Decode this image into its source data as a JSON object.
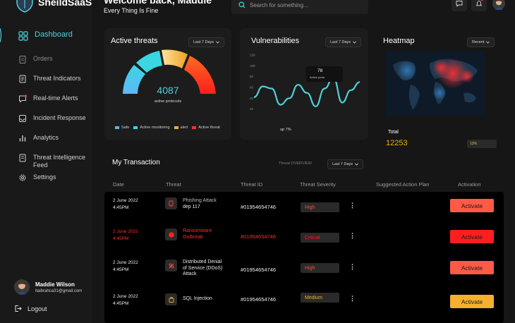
{
  "brand": {
    "name": "SheildSaaS"
  },
  "header": {
    "greeting": "Welcome back, Maddie",
    "tagline": "Every Thing Is Fine",
    "search_placeholder": "Search for something..."
  },
  "sidebar": {
    "items": [
      {
        "label": "Dashboard",
        "icon": "grid-icon",
        "active": true
      },
      {
        "label": "Orders",
        "icon": "clipboard-icon"
      },
      {
        "label": "Threat Indicators",
        "icon": "document-icon"
      },
      {
        "label": "Real-time Alerts",
        "icon": "alert-message-icon"
      },
      {
        "label": "Incident Response",
        "icon": "inbox-icon"
      },
      {
        "label": "Analytics",
        "icon": "bar-chart-icon"
      },
      {
        "label": "Threat Intelligence Feed",
        "icon": "feed-document-icon"
      },
      {
        "label": "Settings",
        "icon": "gear-icon"
      }
    ],
    "user": {
      "name": "Maddie Wilson",
      "email": "itaibrahca31@gmail.com"
    },
    "logout_label": "Logout"
  },
  "active_threats": {
    "title": "Active threats",
    "range": "Last 7 Days",
    "value": "4087",
    "caption": "active protocols",
    "legend": [
      {
        "label": "Safe",
        "color": "#4fb8f0"
      },
      {
        "label": "Active monitoring",
        "color": "#39d6e0"
      },
      {
        "label": "alert",
        "color": "#f0b030"
      },
      {
        "label": "Active threat",
        "color": "#ff3030"
      }
    ]
  },
  "vulnerabilities": {
    "title": "Vulnerabilities",
    "range": "Last 7 Days",
    "tooltip_value": "78",
    "tooltip_label": "Active ports",
    "footer": "up 7%"
  },
  "chart_data": {
    "type": "line",
    "title": "Vulnerabilities",
    "ylim": [
      0,
      120
    ],
    "y_ticks": [
      "120",
      "100",
      "80",
      "60",
      "40",
      "20"
    ],
    "series": [
      {
        "values": [
          42,
          62,
          58,
          28,
          40,
          65,
          50,
          25,
          58,
          78,
          32,
          55,
          70
        ]
      }
    ]
  },
  "heatmap": {
    "title": "Heatmap",
    "range": "Recent",
    "total_label": "Total",
    "total_value": "12253",
    "percent": "13%"
  },
  "transactions": {
    "title": "My Transaction",
    "overview_label": "Threat OVERVIEW",
    "range": "Last 7 Days",
    "columns": [
      "Date",
      "Threat",
      "Threat ID",
      "Threat Severity",
      "Suggested Action Plan",
      "Activation"
    ],
    "rows": [
      {
        "date": "2 June 2022",
        "time": "4:45PM",
        "threat": "Phishing Attack",
        "threat_sub": "dep 117",
        "id": "#01954654746",
        "severity": "High",
        "severity_color": "#ff4a3a",
        "action": "Activate",
        "action_color": "#ff5a45",
        "critical": false,
        "icon": "phishing-icon"
      },
      {
        "date": "2 June 2022",
        "time": "4:45PM",
        "threat": "Ransomware Outbreak",
        "threat_sub": "",
        "id": "#01954654746",
        "severity": "Critical",
        "severity_color": "#ff1a1a",
        "action": "Activate",
        "action_color": "#ff1e1e",
        "critical": true,
        "icon": "ransomware-icon"
      },
      {
        "date": "2 June 2022",
        "time": "4:45PM",
        "threat": "Distributed Denial of Service (DDoS) Attack",
        "threat_sub": "",
        "id": "#01954654746",
        "severity": "High",
        "severity_color": "#ff4a3a",
        "action": "Activate",
        "action_color": "#ff5a45",
        "critical": false,
        "icon": "ddos-icon"
      },
      {
        "date": "2 June 2022",
        "time": "4:45PM",
        "threat": "SQL Injection",
        "threat_sub": "",
        "id": "#01954654746",
        "severity": "Medium",
        "severity_color": "#f0b030",
        "action": "Activate",
        "action_color": "#f5b02e",
        "critical": false,
        "icon": "sql-icon"
      }
    ]
  }
}
